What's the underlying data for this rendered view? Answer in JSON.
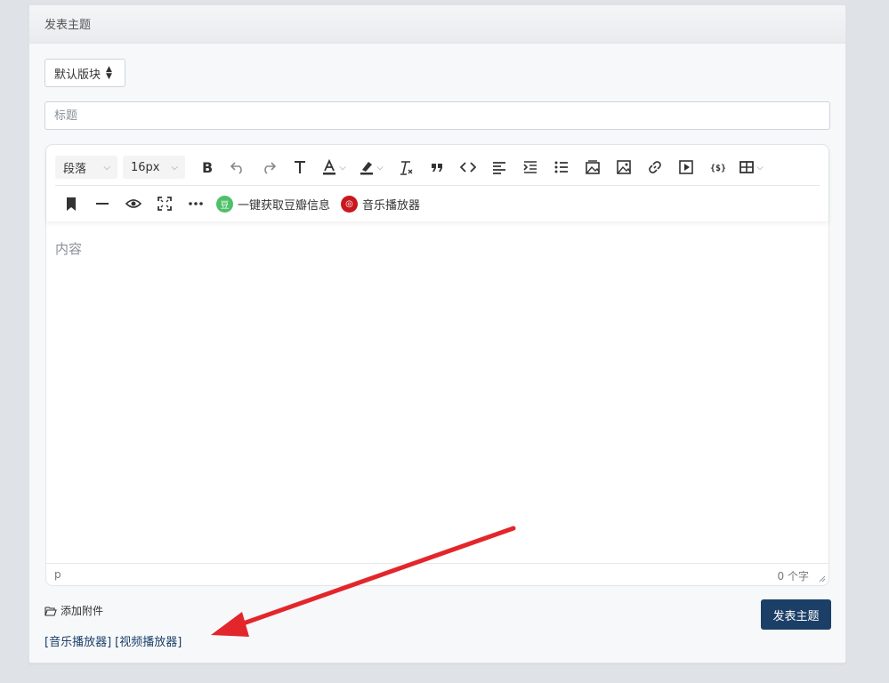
{
  "card": {
    "title": "发表主题"
  },
  "board_select": {
    "value": "默认版块"
  },
  "title_input": {
    "placeholder": "标题"
  },
  "toolbar": {
    "paragraph_select": "段落",
    "fontsize_select": "16px",
    "douban_label": "一键获取豆瓣信息",
    "douban_badge": "豆",
    "music_label": "音乐播放器"
  },
  "editor": {
    "placeholder": "内容",
    "status_path": "p",
    "word_count": "0 个字"
  },
  "attachment": {
    "label": "添加附件"
  },
  "player_links": {
    "music": "[音乐播放器]",
    "video": "[视频播放器]"
  },
  "submit_button": "发表主题",
  "colors": {
    "primary": "#1c3f67",
    "arrow": "#e3262b",
    "douban": "#4fbf6a",
    "music": "#c8181e"
  }
}
